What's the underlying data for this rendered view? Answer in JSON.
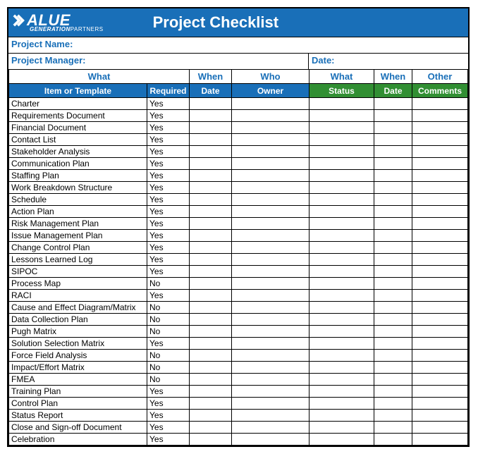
{
  "brand": {
    "name_top": "ALUE",
    "name_bottom_gen": "GENERATION",
    "name_bottom_partners": "PARTNERS"
  },
  "title": "Project Checklist",
  "meta": {
    "project_name_label": "Project Name:",
    "project_manager_label": "Project Manager:",
    "date_label": "Date:"
  },
  "groups": {
    "what1": "What",
    "when1": "When",
    "who": "Who",
    "what2": "What",
    "when2": "When",
    "other": "Other"
  },
  "headers": {
    "item": "Item or Template",
    "required": "Required",
    "date1": "Date",
    "owner": "Owner",
    "status": "Status",
    "date2": "Date",
    "comments": "Comments"
  },
  "rows": [
    {
      "item": "Charter",
      "required": "Yes"
    },
    {
      "item": "Requirements Document",
      "required": "Yes"
    },
    {
      "item": "Financial Document",
      "required": "Yes"
    },
    {
      "item": "Contact List",
      "required": "Yes"
    },
    {
      "item": "Stakeholder Analysis",
      "required": "Yes"
    },
    {
      "item": "Communication Plan",
      "required": "Yes"
    },
    {
      "item": "Staffing Plan",
      "required": "Yes"
    },
    {
      "item": "Work Breakdown Structure",
      "required": "Yes"
    },
    {
      "item": "Schedule",
      "required": "Yes"
    },
    {
      "item": "Action Plan",
      "required": "Yes"
    },
    {
      "item": "Risk Management Plan",
      "required": "Yes"
    },
    {
      "item": "Issue Management Plan",
      "required": "Yes"
    },
    {
      "item": "Change Control Plan",
      "required": "Yes"
    },
    {
      "item": "Lessons Learned Log",
      "required": "Yes"
    },
    {
      "item": "SIPOC",
      "required": "Yes"
    },
    {
      "item": "Process Map",
      "required": "No"
    },
    {
      "item": "RACI",
      "required": "Yes"
    },
    {
      "item": "Cause and Effect Diagram/Matrix",
      "required": "No"
    },
    {
      "item": "Data Collection Plan",
      "required": "No"
    },
    {
      "item": "Pugh Matrix",
      "required": "No"
    },
    {
      "item": "Solution Selection Matrix",
      "required": "Yes"
    },
    {
      "item": "Force Field Analysis",
      "required": "No"
    },
    {
      "item": "Impact/Effort Matrix",
      "required": "No"
    },
    {
      "item": "FMEA",
      "required": "No"
    },
    {
      "item": "Training Plan",
      "required": "Yes"
    },
    {
      "item": "Control Plan",
      "required": "Yes"
    },
    {
      "item": "Status Report",
      "required": "Yes"
    },
    {
      "item": "Close and Sign-off Document",
      "required": "Yes"
    },
    {
      "item": "Celebration",
      "required": "Yes"
    }
  ]
}
